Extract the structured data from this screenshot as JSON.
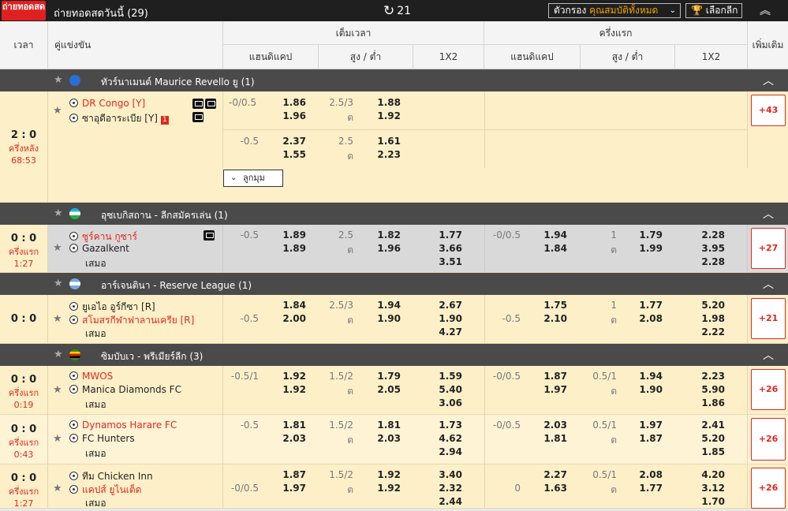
{
  "topbar": {
    "live_label": "ถ่ายทอดสด",
    "title": "ถ่ายทอดสดวันนี้ (29)",
    "refresh_count": "21",
    "filter_label": "ตัวกรอง",
    "filter_value": "คุณสมบัติทั้งหมด",
    "league_pick": "เลือกลีก"
  },
  "header": {
    "time": "เวลา",
    "match": "คู่แข่งขัน",
    "fulltime": "เต็มเวลา",
    "firsthalf": "ครึ่งแรก",
    "handicap": "แฮนดิแคป",
    "overunder": "สูง / ต่ำ",
    "x12": "1X2",
    "more": "เพิ่มเติม"
  },
  "leagues": [
    {
      "name": "ทัวร์นาเมนต์ Maurice Revello ยู (1)"
    },
    {
      "name": "อุซเบกิสถาน - ลีกสมัครเล่น (1)"
    },
    {
      "name": "อาร์เจนตินา - Reserve League (1)"
    },
    {
      "name": "ซิมบับเว - พรีเมียร์ลีก (3)"
    }
  ],
  "matches": [
    {
      "score": "2 : 0",
      "period": "ครึ่งหลัง",
      "clock": "68:53",
      "home": "DR Congo [Y]",
      "away": "ซาอุดีอาระเบีย [Y]",
      "away_card": "1",
      "ft_rows": [
        {
          "hdp": "-0/0.5",
          "h1": "1.86",
          "h2": "1.96",
          "ou": "2.5/3",
          "ou_u": "ต",
          "o1": "1.88",
          "o2": "1.92"
        },
        {
          "hdp": "-0.5",
          "h1": "2.37",
          "h2": "1.55",
          "ou": "2.5",
          "ou_u": "ต",
          "o1": "1.61",
          "o2": "2.23"
        }
      ],
      "more": "+43",
      "detail_btn": "ลูกมุม"
    },
    {
      "score": "0 : 0",
      "period": "ครึ่งแรก",
      "clock": "1:27",
      "home": "ซูร์คาน กูซาร์",
      "away": "Gazalkent",
      "draw": "เสมอ",
      "ft": {
        "hdp": "-0.5",
        "h1": "1.89",
        "h2": "1.89",
        "ou": "2.5",
        "ou_u": "ต",
        "o1": "1.82",
        "o2": "1.96",
        "x1": "1.77",
        "x2": "3.66",
        "xd": "3.51"
      },
      "fh": {
        "hdp": "-0/0.5",
        "h1": "1.94",
        "h2": "1.84",
        "ou": "1",
        "ou_u": "ต",
        "o1": "1.79",
        "o2": "1.99",
        "x1": "2.28",
        "x2": "3.95",
        "xd": "2.28"
      },
      "more": "+27"
    },
    {
      "score": "0 : 0",
      "period": "",
      "clock": "",
      "home": "ยูเอไอ อูร์กีซา [R]",
      "away": "สโมสรกีฬาฟาลานเครีย [R]",
      "draw": "เสมอ",
      "ft": {
        "hdp": "-0.5",
        "h1": "1.84",
        "h2": "2.00",
        "ou": "2.5/3",
        "ou_u": "ต",
        "o1": "1.94",
        "o2": "1.90",
        "x1": "2.67",
        "x2": "1.90",
        "xd": "4.27"
      },
      "fh": {
        "hdp": "-0.5",
        "h1": "1.75",
        "h2": "2.10",
        "ou": "1",
        "ou_u": "ต",
        "o1": "1.77",
        "o2": "2.08",
        "x1": "5.20",
        "x2": "1.98",
        "xd": "2.22"
      },
      "more": "+21"
    },
    {
      "score": "0 : 0",
      "period": "ครึ่งแรก",
      "clock": "0:19",
      "home": "MWOS",
      "away": "Manica Diamonds FC",
      "draw": "เสมอ",
      "ft": {
        "hdp": "-0.5/1",
        "h1": "1.92",
        "h2": "1.92",
        "ou": "1.5/2",
        "ou_u": "ต",
        "o1": "1.79",
        "o2": "2.05",
        "x1": "1.59",
        "x2": "5.40",
        "xd": "3.06"
      },
      "fh": {
        "hdp": "-0/0.5",
        "h1": "1.87",
        "h2": "1.97",
        "ou": "0.5/1",
        "ou_u": "ต",
        "o1": "1.94",
        "o2": "1.90",
        "x1": "2.23",
        "x2": "5.90",
        "xd": "1.86"
      },
      "more": "+26"
    },
    {
      "score": "0 : 0",
      "period": "ครึ่งแรก",
      "clock": "0:43",
      "home": "Dynamos Harare FC",
      "away": "FC Hunters",
      "draw": "เสมอ",
      "ft": {
        "hdp": "-0.5",
        "h1": "1.81",
        "h2": "2.03",
        "ou": "1.5/2",
        "ou_u": "ต",
        "o1": "1.81",
        "o2": "2.03",
        "x1": "1.73",
        "x2": "4.62",
        "xd": "2.94"
      },
      "fh": {
        "hdp": "-0/0.5",
        "h1": "2.03",
        "h2": "1.81",
        "ou": "0.5/1",
        "ou_u": "ต",
        "o1": "1.97",
        "o2": "1.87",
        "x1": "2.41",
        "x2": "5.20",
        "xd": "1.85"
      },
      "more": "+26"
    },
    {
      "score": "0 : 0",
      "period": "ครึ่งแรก",
      "clock": "1:27",
      "home": "ทีม Chicken Inn",
      "away": "แคปส์ ยูไนเต็ด",
      "draw": "เสมอ",
      "ft": {
        "hdp": "-0/0.5",
        "h1": "1.87",
        "h2": "1.97",
        "ou": "1.5/2",
        "ou_u": "ต",
        "o1": "1.92",
        "o2": "1.92",
        "x1": "3.40",
        "x2": "2.32",
        "xd": "2.44"
      },
      "fh": {
        "hdp": "0",
        "h1": "2.27",
        "h2": "1.63",
        "ou": "0.5/1",
        "ou_u": "ต",
        "o1": "2.08",
        "o2": "1.77",
        "x1": "4.20",
        "x2": "3.12",
        "xd": "1.70"
      },
      "more": "+26"
    }
  ]
}
